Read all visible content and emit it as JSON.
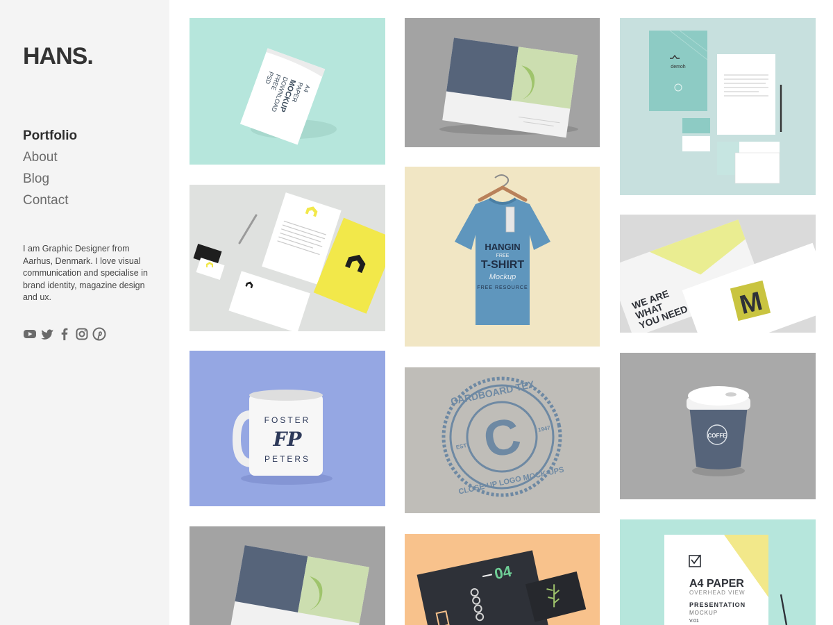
{
  "site": {
    "logo": "HANS."
  },
  "nav": {
    "items": [
      "Portfolio",
      "About",
      "Blog",
      "Contact"
    ],
    "active": "Portfolio"
  },
  "bio": "I am Graphic Designer from Aarhus, Denmark. I love visual communication and specialise in brand identity, magazine design and ux.",
  "social": [
    "youtube-icon",
    "twitter-icon",
    "facebook-icon",
    "instagram-icon",
    "pinterest-icon"
  ],
  "colors": {
    "sidebar": "#f4f4f4",
    "text": "#333333",
    "mint": "#b6e6dc",
    "yellow": "#f2e84a",
    "periwinkle": "#95a7e3",
    "peach": "#f8c28c"
  },
  "tiles": {
    "paper": {
      "lines": [
        "A4",
        "PAPER",
        "MOCKUP",
        "DOWNLOAD",
        "FREE",
        "PSD"
      ]
    },
    "stationery_mint": {
      "brand": "demoh"
    },
    "tshirt": {
      "lines": [
        "HANGIN",
        "FREE",
        "T-SHIRT",
        "Mockup",
        "FREE RESOURCE"
      ]
    },
    "envelopes": {
      "tagline": [
        "WE ARE",
        "WHAT",
        "YOU NEED"
      ],
      "letter": "M"
    },
    "mug": {
      "top": "FOSTER",
      "monogram": "FP",
      "bottom": "PETERS"
    },
    "cardboard": {
      "ring_top": "CARDBOARD TEX",
      "ring_bottom": "CLOSE-UP LOGO MOCK-UPS",
      "letter": "C",
      "est": "EST",
      "year": "1947"
    },
    "cup": {
      "label": "COFFE"
    },
    "notebook": {
      "number": "04"
    },
    "a4_presentation": {
      "title": "A4 PAPER",
      "subtitle": "OVERHEAD VIEW",
      "line1": "PRESENTATION",
      "line2": "MOCKUP",
      "version": "V.01"
    }
  }
}
